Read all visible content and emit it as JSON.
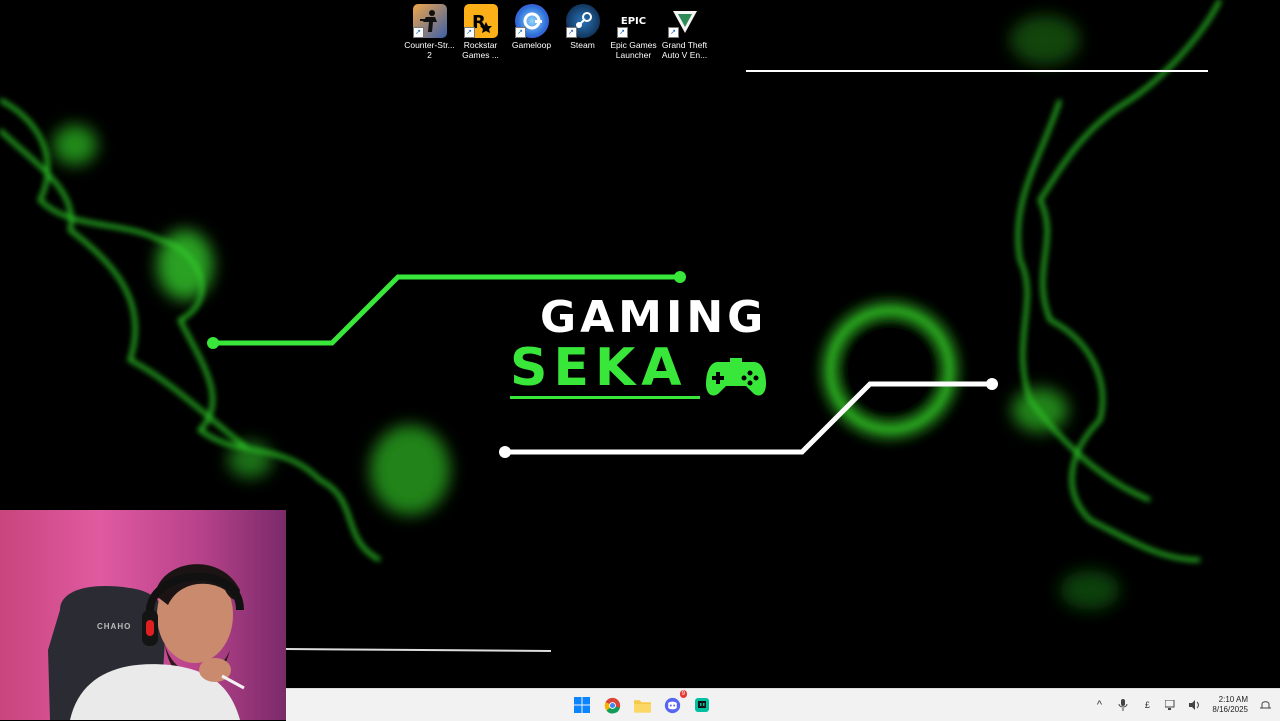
{
  "desktop": {
    "icons": [
      {
        "label": "Counter-Str... 2",
        "icon": "counter-strike-icon"
      },
      {
        "label": "Rockstar Games ...",
        "icon": "rockstar-icon"
      },
      {
        "label": "Gameloop",
        "icon": "gameloop-icon"
      },
      {
        "label": "Steam",
        "icon": "steam-icon"
      },
      {
        "label": "Epic Games Launcher",
        "icon": "epic-games-icon",
        "badge_text": "EPIC"
      },
      {
        "label": "Grand Theft Auto V En...",
        "icon": "gta-v-icon"
      }
    ]
  },
  "wallpaper": {
    "title_line1": "GAMING",
    "title_line2": "SEKA",
    "accent_color": "#39e63a"
  },
  "webcam": {
    "chair_brand": "CHAHO"
  },
  "taskbar": {
    "apps": [
      "windows-start-icon",
      "chrome-icon",
      "file-explorer-icon",
      "discord-icon",
      "twitch-icon"
    ],
    "discord_badge": "9",
    "tray": {
      "clock_time": "2:10 AM",
      "clock_date": "8/16/2025"
    }
  }
}
